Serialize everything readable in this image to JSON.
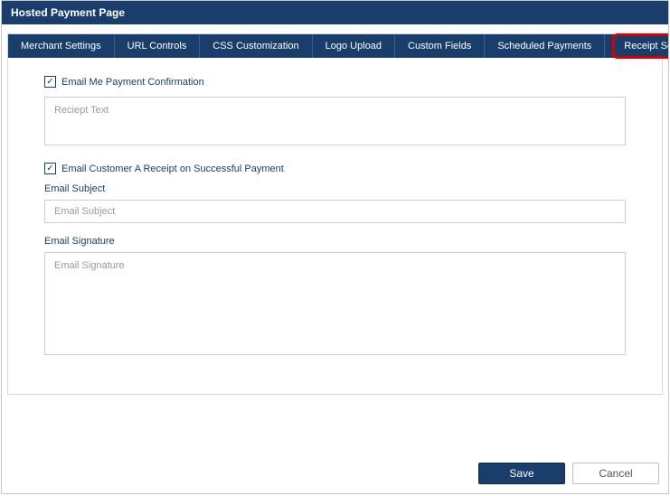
{
  "header": {
    "title": "Hosted Payment Page"
  },
  "tabs": [
    {
      "label": "Merchant Settings"
    },
    {
      "label": "URL Controls"
    },
    {
      "label": "CSS Customization"
    },
    {
      "label": "Logo Upload"
    },
    {
      "label": "Custom Fields"
    },
    {
      "label": "Scheduled Payments"
    }
  ],
  "active_tab": {
    "label": "Receipt Settings"
  },
  "form": {
    "email_me_label": "Email Me Payment Confirmation",
    "receipt_text_placeholder": "Reciept Text",
    "email_customer_label": "Email Customer A Receipt on Successful Payment",
    "subject_label": "Email Subject",
    "subject_placeholder": "Email Subject",
    "signature_label": "Email Signature",
    "signature_placeholder": "Email Signature"
  },
  "buttons": {
    "save": "Save",
    "cancel": "Cancel"
  }
}
